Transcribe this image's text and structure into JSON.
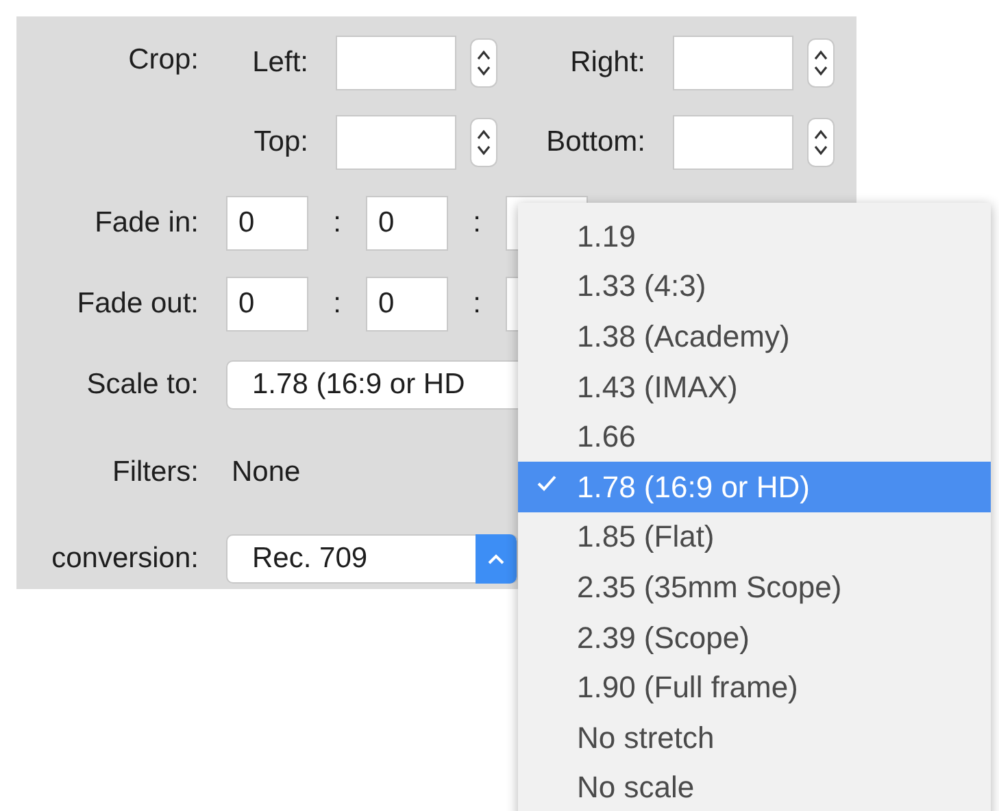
{
  "crop": {
    "label": "Crop:",
    "fields": [
      {
        "label": "Left:"
      },
      {
        "label": "Right:"
      },
      {
        "label": "Top:"
      },
      {
        "label": "Bottom:"
      }
    ]
  },
  "fade_in": {
    "label": "Fade in:",
    "fields": [
      {
        "value": "0"
      },
      {
        "separator": ":",
        "value": "0"
      },
      {
        "separator": ":"
      }
    ]
  },
  "fade_out": {
    "label": "Fade out:",
    "fields": [
      {
        "value": "0"
      },
      {
        "separator": ":",
        "value": "0"
      },
      {
        "separator": ":"
      }
    ]
  },
  "scale_to": {
    "label": "Scale to:",
    "value": "1.78 (16:9 or HD"
  },
  "filters": {
    "label": "Filters:",
    "value": "None"
  },
  "conversion": {
    "label": "conversion:",
    "value": "Rec. 709"
  },
  "scale_menu": [
    {
      "label": "1.19",
      "selected": false
    },
    {
      "label": "1.33 (4:3)",
      "selected": false
    },
    {
      "label": "1.38 (Academy)",
      "selected": false
    },
    {
      "label": "1.43 (IMAX)",
      "selected": false
    },
    {
      "label": "1.66",
      "selected": false
    },
    {
      "label": "1.78 (16:9 or HD)",
      "selected": true
    },
    {
      "label": "1.85 (Flat)",
      "selected": false
    },
    {
      "label": "2.35 (35mm Scope)",
      "selected": false
    },
    {
      "label": "2.39 (Scope)",
      "selected": false
    },
    {
      "label": "1.90 (Full frame)",
      "selected": false
    },
    {
      "label": "No stretch",
      "selected": false
    },
    {
      "label": "No scale",
      "selected": false
    }
  ]
}
